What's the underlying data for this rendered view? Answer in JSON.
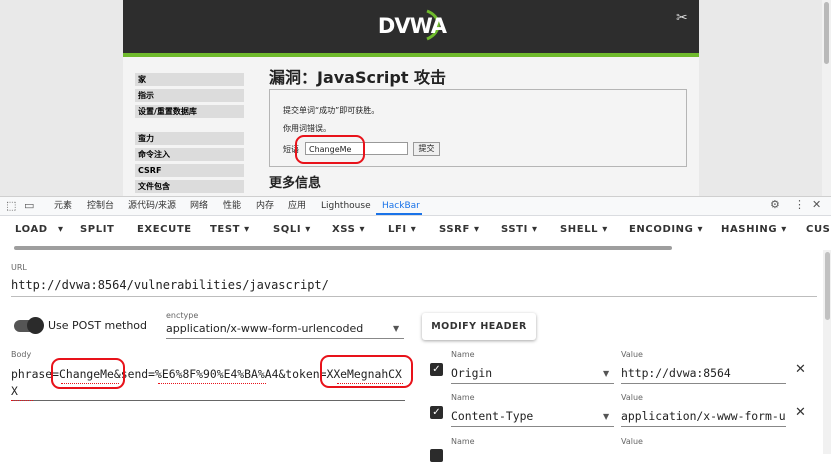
{
  "dvwa": {
    "logo": "DVWA",
    "menu": [
      {
        "label": "家"
      },
      {
        "label": "指示"
      },
      {
        "label": "设置/重置数据库"
      },
      {
        "label": "蛮力"
      },
      {
        "label": "命令注入"
      },
      {
        "label": "CSRF"
      },
      {
        "label": "文件包含"
      }
    ],
    "title": "漏洞：JavaScript 攻击",
    "instruction": "提交单词“成功”即可获胜。",
    "status": "你用词错误。",
    "phrase_label": "短语",
    "phrase_value": "ChangeMe",
    "submit_label": "提交",
    "more_info": "更多信息"
  },
  "devtools": {
    "tabs": [
      {
        "label": "元素"
      },
      {
        "label": "控制台"
      },
      {
        "label": "源代码/来源"
      },
      {
        "label": "网络"
      },
      {
        "label": "性能"
      },
      {
        "label": "内存"
      },
      {
        "label": "应用"
      },
      {
        "label": "Lighthouse"
      },
      {
        "label": "HackBar"
      }
    ],
    "active_tab": "HackBar"
  },
  "hackbar": {
    "toolbar": [
      {
        "label": "LOAD"
      },
      {
        "label": "SPLIT"
      },
      {
        "label": "EXECUTE"
      },
      {
        "label": "TEST ▾"
      },
      {
        "label": "SQLI ▾"
      },
      {
        "label": "XSS ▾"
      },
      {
        "label": "LFI ▾"
      },
      {
        "label": "SSRF ▾"
      },
      {
        "label": "SSTI ▾"
      },
      {
        "label": "SHELL ▾"
      },
      {
        "label": "ENCODING ▾"
      },
      {
        "label": "HASHING ▾"
      },
      {
        "label": "CUS"
      }
    ],
    "url_label": "URL",
    "url": "http://dvwa:8564/vulnerabilities/javascript/",
    "post_label": "Use POST method",
    "post_enabled": true,
    "enctype_label": "enctype",
    "enctype": "application/x-www-form-urlencoded",
    "modify_header": "MODIFY HEADER",
    "body_label": "Body",
    "body": "phrase=ChangeMe&send=%E6%8F%90%E4%BA%A4&token=XXeMegnahCXX",
    "headers": [
      {
        "name_label": "Name",
        "name": "Origin",
        "value_label": "Value",
        "value": "http://dvwa:8564",
        "enabled": true
      },
      {
        "name_label": "Name",
        "name": "Content-Type",
        "value_label": "Value",
        "value": "application/x-www-form-urlencoded",
        "enabled": true
      },
      {
        "name_label": "Name",
        "value_label": "Value"
      }
    ]
  },
  "colors": {
    "highlight": "#e8121a",
    "dvwa_green": "#6fba2c",
    "active_tab": "#1a73e8"
  }
}
